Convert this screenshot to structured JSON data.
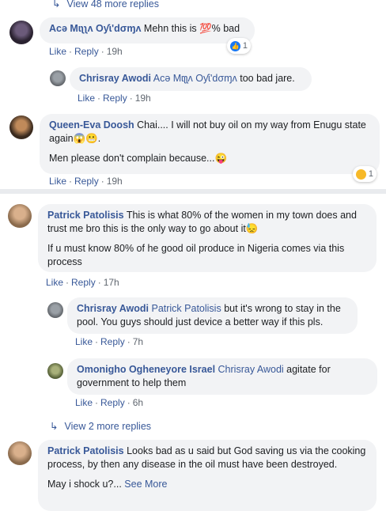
{
  "replies_link_1": {
    "label": "View 48 more replies"
  },
  "replies_link_2": {
    "label": "View 2 more replies"
  },
  "comments": [
    {
      "author": "Acə Mɩʅʅʌ Oƴɩ'dσɱʌ",
      "text": "Mehn this is 💯% bad",
      "like": "Like",
      "reply": "Reply",
      "time": "19h",
      "reaction_count": "1"
    },
    {
      "author": "Chrisray Awodi",
      "mention": "Acə Mɩʅʅʌ Oƴɩ'dσɱʌ",
      "text": "too bad jare.",
      "like": "Like",
      "reply": "Reply",
      "time": "19h"
    },
    {
      "author": "Queen-Eva Doosh",
      "text": "Chai.... I will not buy oil on my way from Enugu state again😱😬.",
      "text2": "Men please don't complain because...😜",
      "like": "Like",
      "reply": "Reply",
      "time": "19h",
      "reaction_count": "1"
    },
    {
      "author": "Patrick Patolisis",
      "text": "This is what 80% of the women in my town does and trust me bro this is the only way to go about it😓",
      "text2": "If u must know 80% of he good oil produce in Nigeria comes via this process",
      "like": "Like",
      "reply": "Reply",
      "time": "17h"
    },
    {
      "author": "Chrisray Awodi",
      "mention": "Patrick Patolisis",
      "text": "but it's wrong to stay in the pool. You guys should just device a better way if this pls.",
      "like": "Like",
      "reply": "Reply",
      "time": "7h"
    },
    {
      "author": "Omonigho Ogheneyore Israel",
      "mention": "Chrisray Awodi",
      "text": "agitate for government to help them",
      "like": "Like",
      "reply": "Reply",
      "time": "6h"
    },
    {
      "author": "Patrick Patolisis",
      "text": "Looks bad as u said but God saving us via the cooking process, by then any disease in the oil must have been destroyed.",
      "text2": "May i shock u?...",
      "see_more": "See More"
    }
  ],
  "colors": {
    "link": "#385898",
    "bubble": "#f2f3f5",
    "meta": "#606770",
    "divider": "#e9ebee"
  },
  "icons": [
    "reply-arrow-icon",
    "like-reaction-icon",
    "haha-reaction-icon"
  ]
}
